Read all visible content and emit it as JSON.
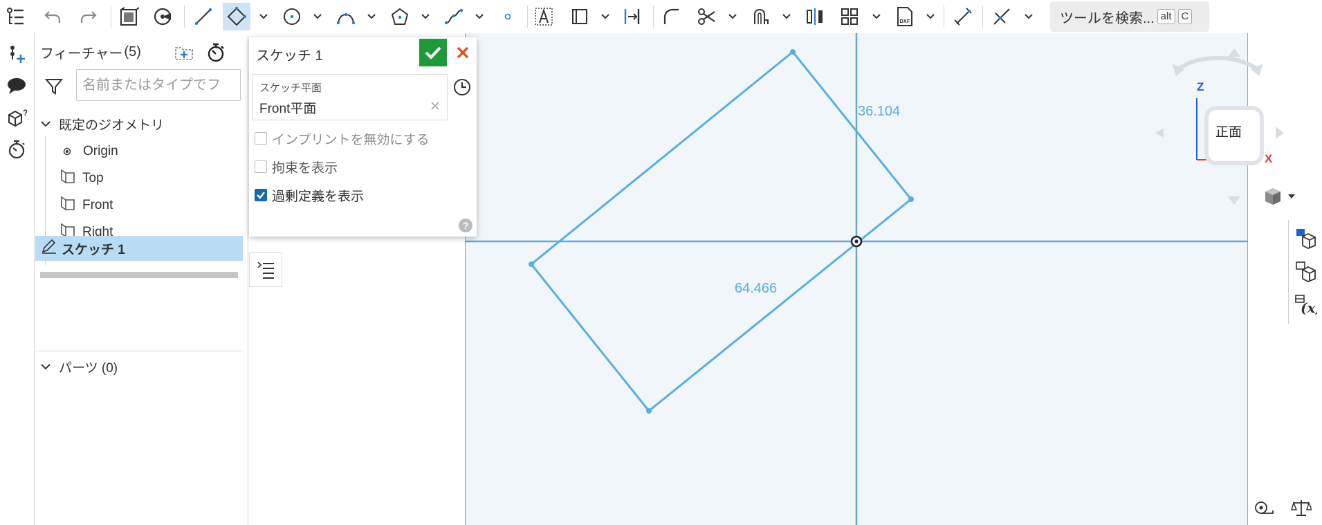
{
  "toolbar": {
    "tools": [
      {
        "id": "undo",
        "icon": "undo-icon"
      },
      {
        "id": "redo",
        "icon": "redo-icon"
      },
      {
        "id": "sketch-plane",
        "icon": "view-normal-icon"
      },
      {
        "id": "section",
        "icon": "section-view-icon"
      },
      {
        "id": "line",
        "icon": "line-icon"
      },
      {
        "id": "rectangle",
        "icon": "rectangle-icon",
        "active": true
      },
      {
        "id": "circle",
        "icon": "circle-icon"
      },
      {
        "id": "arc",
        "icon": "arc-icon"
      },
      {
        "id": "polygon",
        "icon": "polygon-icon"
      },
      {
        "id": "spline",
        "icon": "spline-icon"
      },
      {
        "id": "point",
        "icon": "point-icon"
      },
      {
        "id": "text",
        "icon": "text-icon"
      },
      {
        "id": "construction",
        "icon": "construction-icon"
      },
      {
        "id": "fillet",
        "icon": "fillet-icon"
      },
      {
        "id": "trim",
        "icon": "trim-icon"
      },
      {
        "id": "offset",
        "icon": "offset-icon"
      },
      {
        "id": "mirror",
        "icon": "mirror-icon"
      },
      {
        "id": "pattern",
        "icon": "pattern-icon"
      },
      {
        "id": "dxf",
        "icon": "dxf-import-icon",
        "label": "DXF"
      },
      {
        "id": "dimension",
        "icon": "dimension-icon"
      },
      {
        "id": "constraint",
        "icon": "constraint-icon"
      }
    ],
    "search": {
      "label": "ツールを検索...",
      "key1": "alt",
      "key2": "C"
    }
  },
  "rail": {
    "items": [
      {
        "icon": "feature-list-icon"
      },
      {
        "icon": "add-instance-icon"
      },
      {
        "icon": "comment-icon"
      },
      {
        "icon": "part-studio-help-icon"
      },
      {
        "icon": "history-timer-icon"
      }
    ]
  },
  "feature_panel": {
    "title": "フィーチャー",
    "count": "(5)",
    "search_placeholder": "名前またはタイプでフ",
    "default_geometry": "既定のジオメトリ",
    "origin": "Origin",
    "planes": [
      "Top",
      "Front",
      "Right"
    ],
    "sketch": "スケッチ 1",
    "parts": "パーツ (0)"
  },
  "sketch_dialog": {
    "title": "スケッチ 1",
    "plane_label": "スケッチ平面",
    "plane_value": "Front平面",
    "options": [
      {
        "label": "インプリントを無効にする",
        "checked": false,
        "disabled": true
      },
      {
        "label": "拘束を表示",
        "checked": false,
        "disabled": false
      },
      {
        "label": "過剰定義を表示",
        "checked": true,
        "disabled": false
      }
    ],
    "help": "?"
  },
  "canvas": {
    "dimensions": {
      "short_side": "36.104",
      "long_side": "64.466"
    },
    "view_cube": {
      "face": "正面",
      "axis_z": "Z",
      "axis_x": "X"
    },
    "colors": {
      "sketch": "#5aaee0",
      "axis": "#6aa4d0",
      "background": "#f1f6fa",
      "axis_x": "#e53935",
      "axis_z": "#1e63c8"
    }
  }
}
